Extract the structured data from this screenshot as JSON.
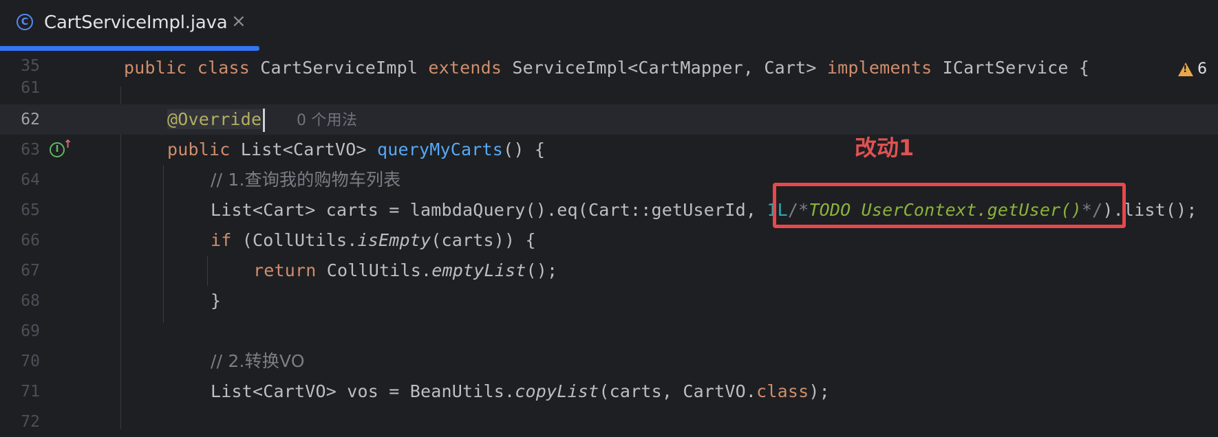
{
  "tab": {
    "icon_letter": "C",
    "title": "CartServiceImpl.java",
    "close": "×"
  },
  "warnings": {
    "count": "6"
  },
  "callout": "改动1",
  "sticky": {
    "line_number": "35",
    "tokens": [
      "public",
      " ",
      "class",
      " CartServiceImpl ",
      "extends",
      " ServiceImpl<CartMapper, Cart> ",
      "implements",
      " ICartService {"
    ]
  },
  "lines": [
    {
      "n": "61"
    },
    {
      "n": "62",
      "annotation": "@Override",
      "hint": "0 个用法"
    },
    {
      "n": "63",
      "t": [
        "public",
        " List<CartVO> ",
        "queryMyCarts",
        "() {"
      ]
    },
    {
      "n": "64",
      "comment": "// 1.查询我的购物车列表"
    },
    {
      "n": "65",
      "t": [
        "List<Cart> carts = lambdaQuery().eq(Cart::getUserId, ",
        "1L",
        "/*",
        "TODO UserContext.getUser()",
        "*/",
        ").list();"
      ]
    },
    {
      "n": "66",
      "t": [
        "if",
        " (CollUtils.",
        "isEmpty",
        "(carts)) {"
      ]
    },
    {
      "n": "67",
      "t": [
        "return",
        " CollUtils.",
        "emptyList",
        "();"
      ]
    },
    {
      "n": "68",
      "t": [
        "}"
      ]
    },
    {
      "n": "69"
    },
    {
      "n": "70",
      "comment": "// 2.转换VO"
    },
    {
      "n": "71",
      "t": [
        "List<CartVO> vos = BeanUtils.",
        "copyList",
        "(carts, CartVO.",
        "class",
        ");"
      ]
    },
    {
      "n": "72"
    }
  ],
  "gutter_icons": {
    "implements": "I",
    "arrow": "↑"
  }
}
